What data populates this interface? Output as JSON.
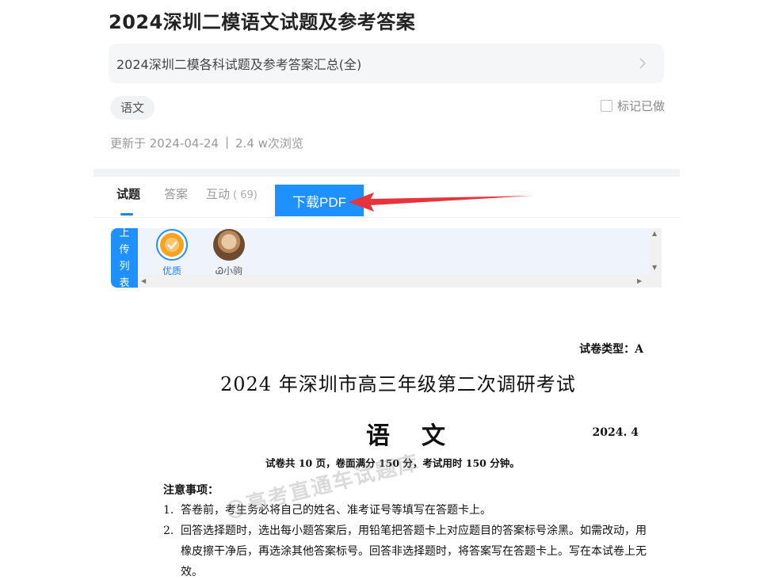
{
  "page": {
    "title": "2024深圳二模语文试题及参考答案",
    "collection_link": "2024深圳二模各科试题及参考答案汇总(全)",
    "subject_tag": "语文",
    "mark_done_label": "标记已做",
    "updated": "更新于 2024-04-24",
    "separator": "|",
    "views": "2.4 w次浏览"
  },
  "tabs": [
    {
      "label": "试题",
      "active": true
    },
    {
      "label": "答案",
      "active": false
    },
    {
      "label": "互动",
      "count": "( 69)",
      "active": false
    }
  ],
  "download_button": "下载PDF",
  "uploader_strip": {
    "list_button": "上传列表",
    "uploaders": [
      {
        "name": "优质",
        "selected": true,
        "icon": "quality-badge-icon"
      },
      {
        "name": "Ꮚ小驹",
        "selected": false,
        "icon": "user-avatar"
      }
    ]
  },
  "document": {
    "paper_type": "试卷类型：A",
    "title": "2024 年深圳市高三年级第二次调研考试",
    "subject": "语文",
    "date": "2024. 4",
    "info": "试卷共 10 页，卷面满分 150 分，考试用时 150 分钟。",
    "notice_heading": "注意事项：",
    "items": [
      {
        "num": "1.",
        "text": "答卷前，考生务必将自己的姓名、准考证号等填写在答题卡上。"
      },
      {
        "num": "2.",
        "text": "回答选择题时，选出每小题答案后，用铅笔把答题卡上对应题目的答案标号涂黑。如需改动，用橡皮擦干净后，再选涂其他答案标号。回答非选择题时，将答案写在答题卡上。写在本试卷上无效。"
      }
    ],
    "watermark": "@高考直通车试题库"
  },
  "colors": {
    "accent": "#1e90ff",
    "arrow": "#e8323c",
    "badge": "#f7a322"
  }
}
